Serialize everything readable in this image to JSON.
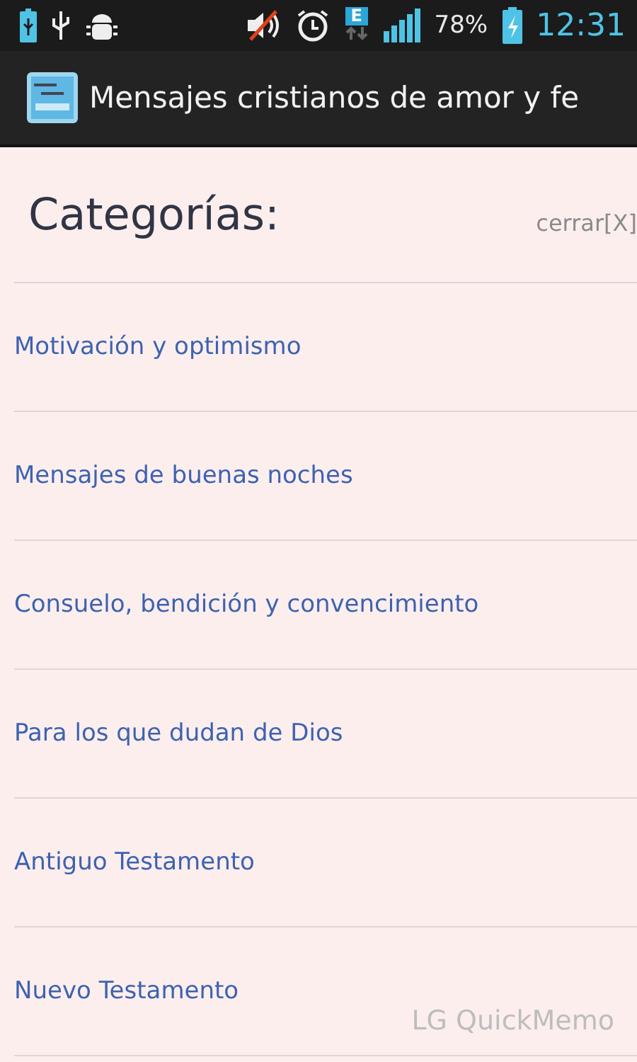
{
  "status_bar": {
    "network_type": "E",
    "battery": "78%",
    "time": "12:31"
  },
  "app_bar": {
    "title": "Mensajes cristianos de amor y fe"
  },
  "header": {
    "title": "Categorías:",
    "close_link": "cerrar[X]"
  },
  "categories": [
    {
      "label": "Motivación y optimismo"
    },
    {
      "label": "Mensajes de buenas noches"
    },
    {
      "label": "Consuelo, bendición y convencimiento"
    },
    {
      "label": "Para los que dudan de Dios"
    },
    {
      "label": "Antiguo Testamento"
    },
    {
      "label": "Nuevo Testamento"
    }
  ],
  "overlay": {
    "text": "LG QuickMemo"
  }
}
